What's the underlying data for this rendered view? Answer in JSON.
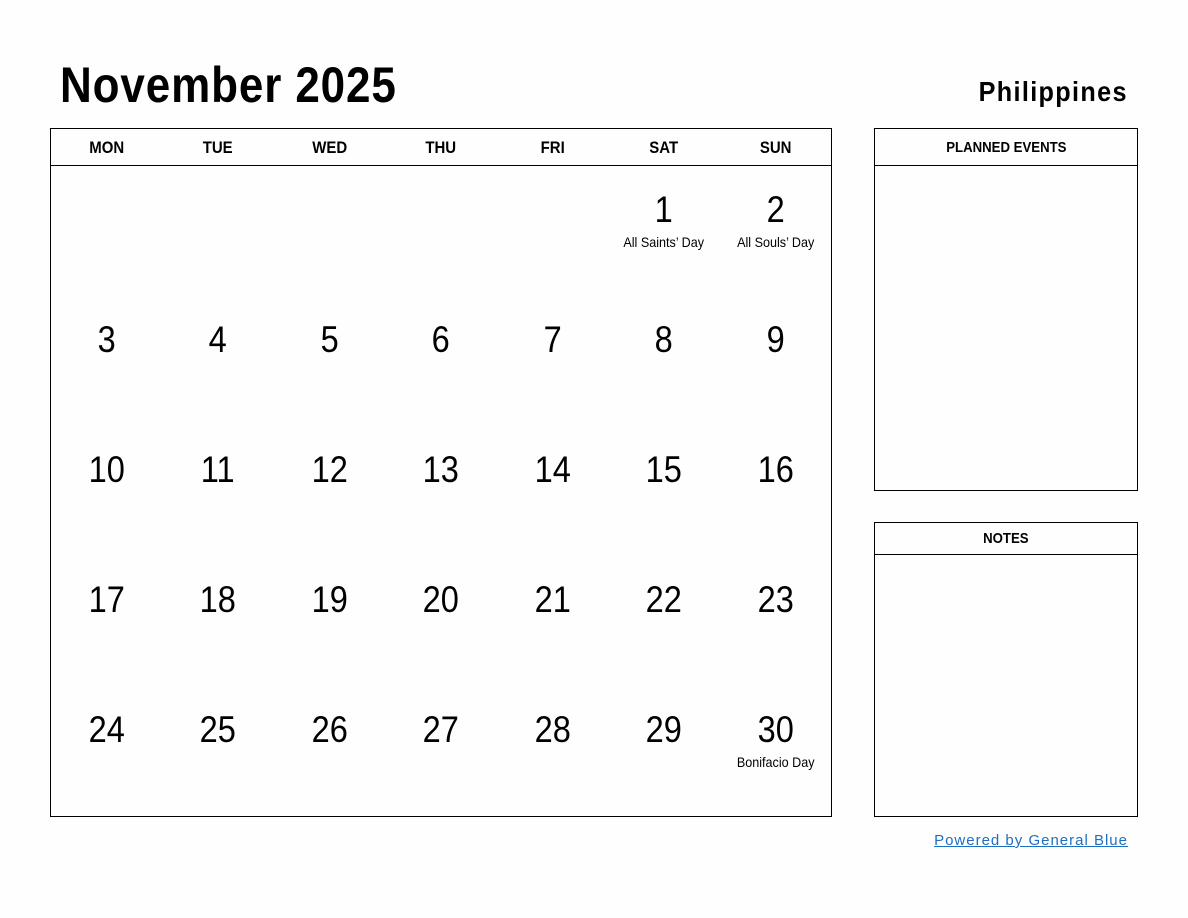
{
  "header": {
    "title": "November 2025",
    "country": "Philippines"
  },
  "calendar": {
    "weekdays": [
      "MON",
      "TUE",
      "WED",
      "THU",
      "FRI",
      "SAT",
      "SUN"
    ],
    "weeks": [
      [
        {
          "day": ""
        },
        {
          "day": ""
        },
        {
          "day": ""
        },
        {
          "day": ""
        },
        {
          "day": ""
        },
        {
          "day": "1",
          "holiday": "All Saints’ Day"
        },
        {
          "day": "2",
          "holiday": "All Souls’ Day"
        }
      ],
      [
        {
          "day": "3"
        },
        {
          "day": "4"
        },
        {
          "day": "5"
        },
        {
          "day": "6"
        },
        {
          "day": "7"
        },
        {
          "day": "8"
        },
        {
          "day": "9"
        }
      ],
      [
        {
          "day": "10"
        },
        {
          "day": "11"
        },
        {
          "day": "12"
        },
        {
          "day": "13"
        },
        {
          "day": "14"
        },
        {
          "day": "15"
        },
        {
          "day": "16"
        }
      ],
      [
        {
          "day": "17"
        },
        {
          "day": "18"
        },
        {
          "day": "19"
        },
        {
          "day": "20"
        },
        {
          "day": "21"
        },
        {
          "day": "22"
        },
        {
          "day": "23"
        }
      ],
      [
        {
          "day": "24"
        },
        {
          "day": "25"
        },
        {
          "day": "26"
        },
        {
          "day": "27"
        },
        {
          "day": "28"
        },
        {
          "day": "29"
        },
        {
          "day": "30",
          "holiday": "Bonifacio Day"
        }
      ]
    ]
  },
  "panels": {
    "planned_events": "PLANNED EVENTS",
    "notes": "NOTES"
  },
  "footer": {
    "powered_by": "Powered by General Blue",
    "link_color": "#1f6fbf"
  }
}
